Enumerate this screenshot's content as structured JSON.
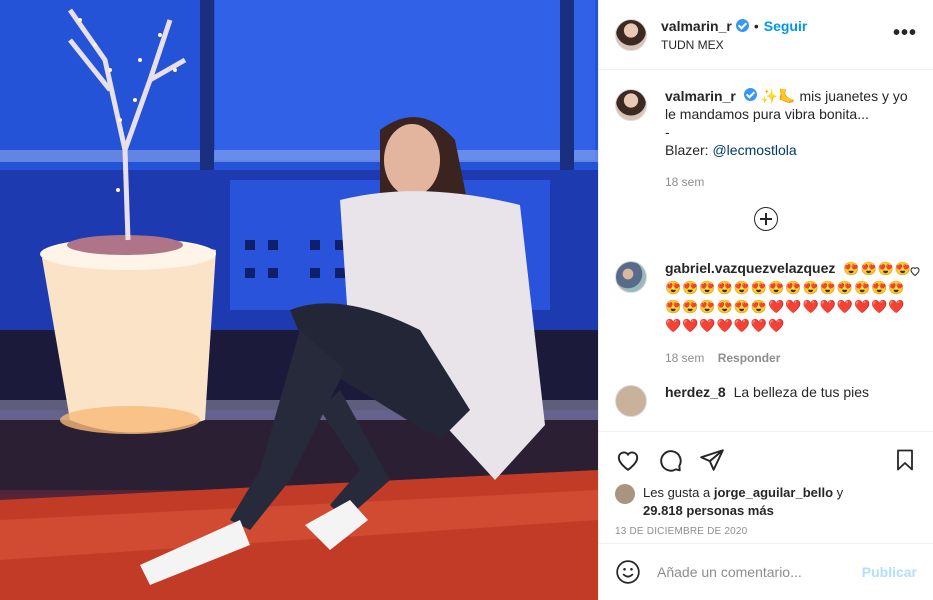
{
  "post": {
    "username": "valmarin_r",
    "follow_label": "Seguir",
    "separator": "•",
    "location": "TUDN MEX",
    "more_label": "•••"
  },
  "caption": {
    "username": "valmarin_r",
    "text_line1": "✨🦶 mis juanetes y yo le mandamos pura vibra bonita...",
    "text_line2": "-",
    "blazer_prefix": "Blazer: ",
    "mention": "@lecmostlola",
    "time": "18 sem"
  },
  "comments": [
    {
      "username": "gabriel.vazquezvelazquez",
      "text": "😍😍😍😍😍😍😍😍😍😍😍😍😍😍😍😍😍😍😍😍😍😍😍😍❤️❤️❤️❤️❤️❤️❤️❤️❤️❤️❤️❤️❤️❤️❤️",
      "time": "18 sem",
      "reply_label": "Responder"
    },
    {
      "username": "herdez_8",
      "text": "La belleza de tus pies"
    }
  ],
  "likes": {
    "prefix": "Les gusta a ",
    "user": "jorge_aguilar_bello",
    "connector": " y",
    "count": "29.818 personas más"
  },
  "date": "13 DE DICIEMBRE DE 2020",
  "comment_box": {
    "placeholder": "Añade un comentario...",
    "post_label": "Publicar"
  },
  "icons": {
    "like": "heart-icon",
    "comment": "comment-icon",
    "share": "share-icon",
    "save": "bookmark-icon",
    "emoji": "emoji-icon",
    "expand": "plus-circle-icon"
  },
  "colors": {
    "accent": "#0095f6",
    "verified": "#3897f0",
    "post_disabled": "#b2dffc"
  }
}
